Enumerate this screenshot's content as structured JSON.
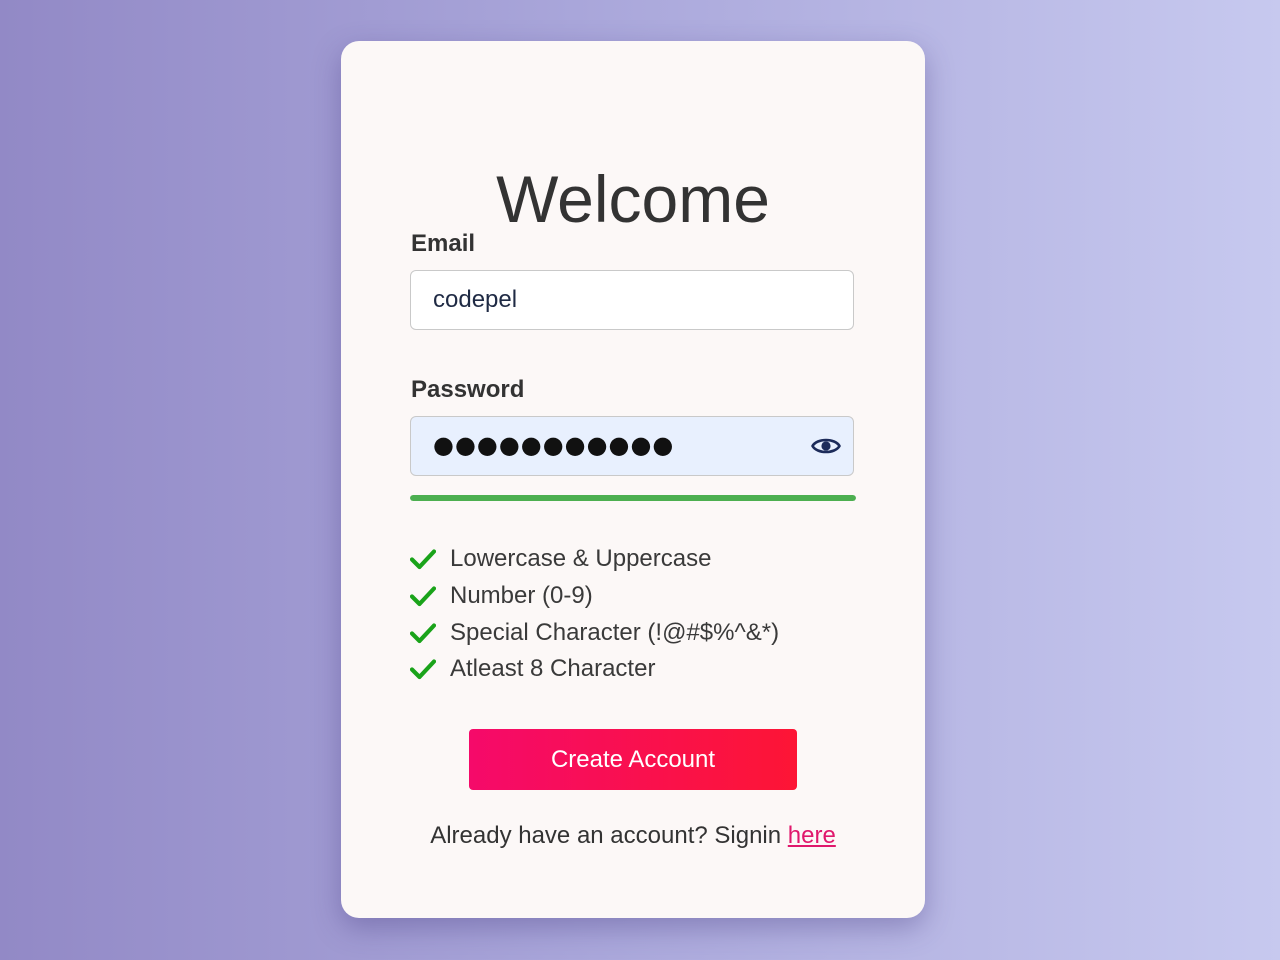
{
  "form": {
    "title": "Welcome",
    "email": {
      "label": "Email",
      "value": "codepel"
    },
    "password": {
      "label": "Password",
      "masked_value": "●●●●●●●●●●●",
      "visibility_icon": "eye-icon"
    },
    "strength": {
      "level": 1.0,
      "color": "#4caf50"
    },
    "requirements": [
      {
        "text": "Lowercase & Uppercase",
        "met": true
      },
      {
        "text": "Number (0-9)",
        "met": true
      },
      {
        "text": "Special Character (!@#$%^&*)",
        "met": true
      },
      {
        "text": "Atleast 8 Character",
        "met": true
      }
    ],
    "submit_label": "Create Account",
    "signin": {
      "prompt": "Already have an account? Signin ",
      "link_text": "here"
    }
  },
  "colors": {
    "check": "#1aa31a",
    "button_start": "#f50a6a",
    "button_end": "#fd1535",
    "link": "#e0186c",
    "password_field_bg": "#e8f0fe"
  }
}
